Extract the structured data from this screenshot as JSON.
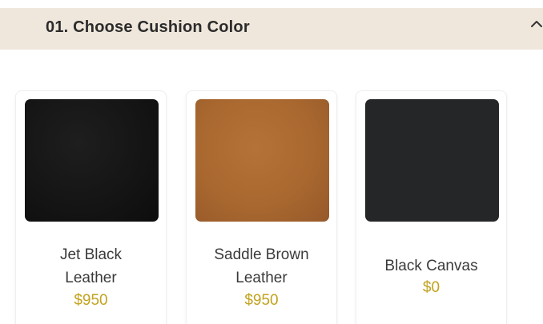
{
  "section": {
    "title": "01. Choose Cushion Color",
    "toggle_icon": "chevron-up-icon"
  },
  "colors": {
    "header_bg": "#f0e7dc",
    "price": "#c2a21e"
  },
  "options": [
    {
      "name_line1": "Jet Black",
      "name_line2": "Leather",
      "price": "$950",
      "swatch_color": "#151515"
    },
    {
      "name_line1": "Saddle Brown",
      "name_line2": "Leather",
      "price": "$950",
      "swatch_color": "#ad6b34"
    },
    {
      "name_line1": "Black Canvas",
      "name_line2": "",
      "price": "$0",
      "swatch_color": "#252627"
    }
  ]
}
